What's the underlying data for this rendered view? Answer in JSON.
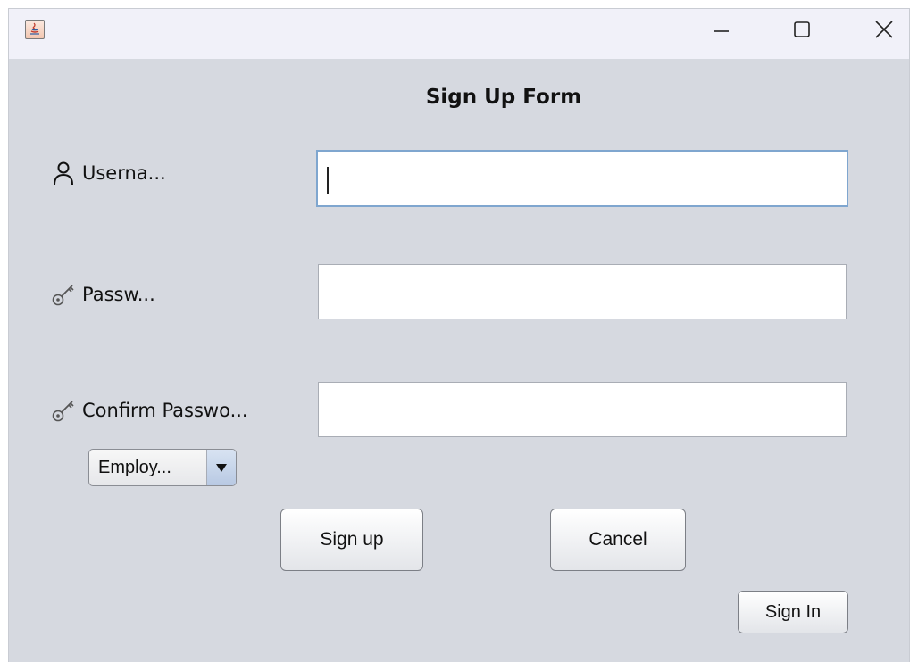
{
  "window": {
    "app_icon": "java-cup-icon",
    "controls": {
      "minimize_icon": "minimize-icon",
      "maximize_icon": "maximize-icon",
      "close_icon": "close-icon"
    }
  },
  "form": {
    "title": "Sign Up Form",
    "username": {
      "label": "Userna...",
      "icon": "user-icon",
      "value": ""
    },
    "password": {
      "label": "Passw...",
      "icon": "key-icon",
      "value": ""
    },
    "confirm_password": {
      "label": "Confirm Passwo...",
      "icon": "key-icon",
      "value": ""
    },
    "role_select": {
      "selected": "Employ..."
    },
    "buttons": {
      "sign_up": "Sign up",
      "cancel": "Cancel",
      "sign_in": "Sign In"
    }
  },
  "colors": {
    "background": "#d6d9e0",
    "titlebar": "#f1f1f9",
    "focus_border": "#7fa6cf"
  }
}
